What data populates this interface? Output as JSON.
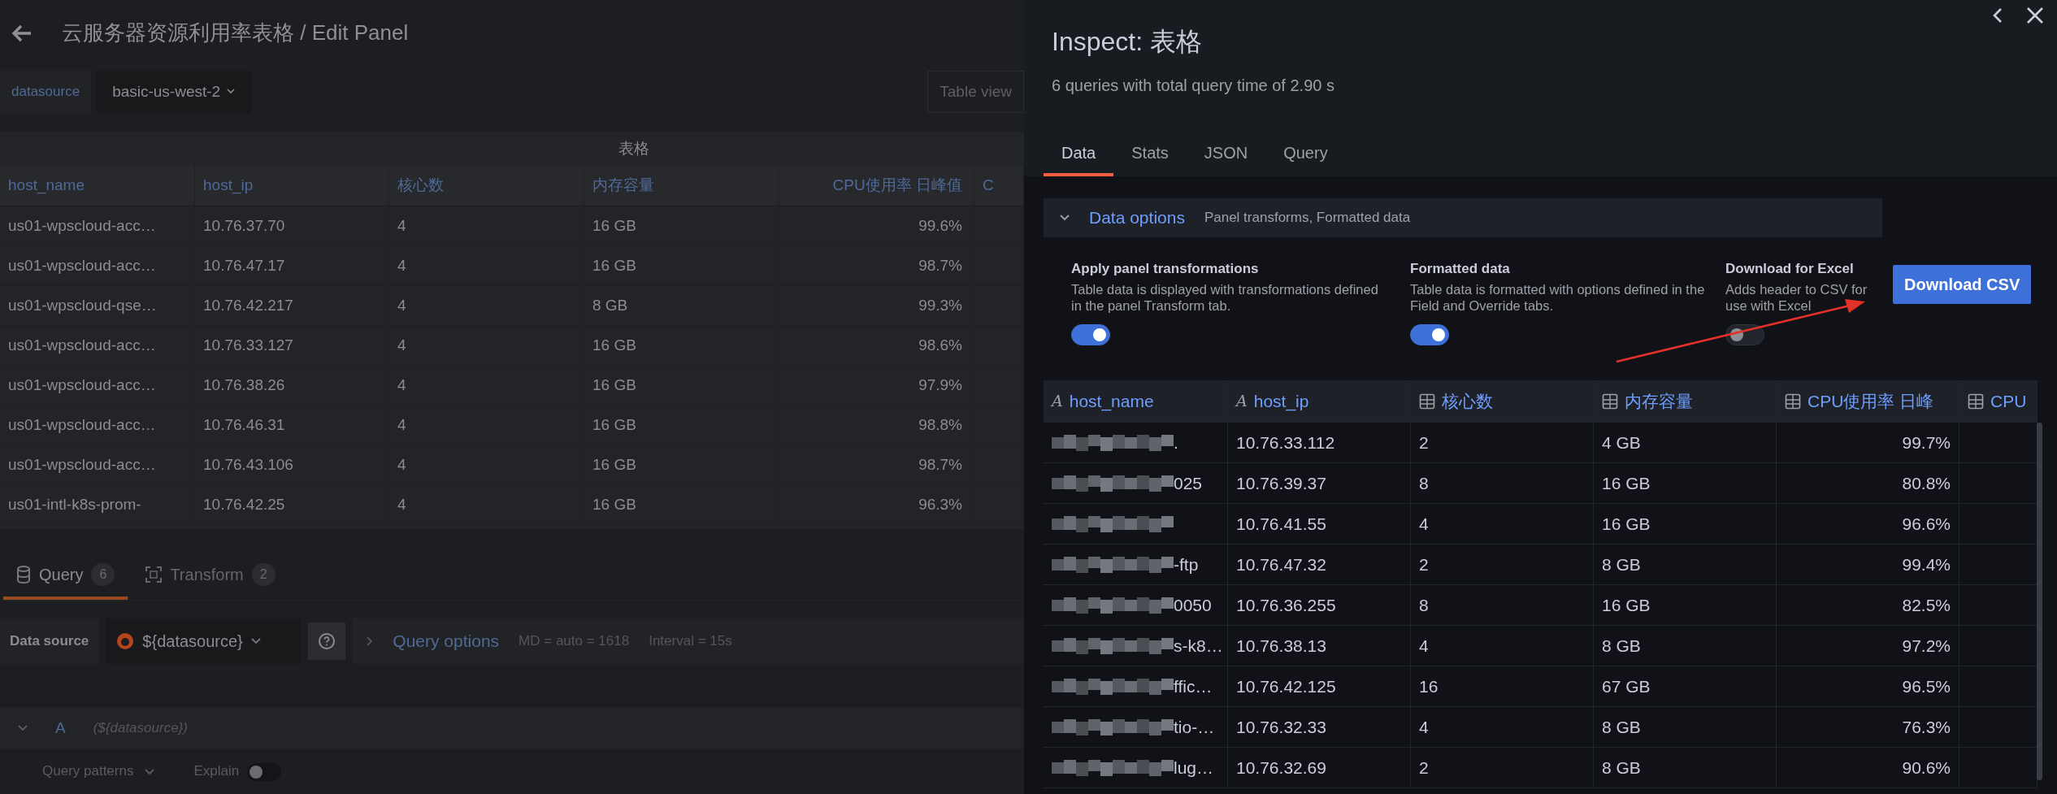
{
  "editor": {
    "title": "云服务器资源利用率表格 / Edit Panel",
    "variable": {
      "label": "datasource",
      "value": "basic-us-west-2"
    },
    "view_button": "Table view",
    "panel": {
      "title": "表格",
      "columns": [
        "host_name",
        "host_ip",
        "核心数",
        "内存容量",
        "CPU使用率 日峰值",
        "C"
      ],
      "rows": [
        [
          "us01-wpscloud-acc…",
          "10.76.37.70",
          "4",
          "16 GB",
          "99.6%"
        ],
        [
          "us01-wpscloud-acc…",
          "10.76.47.17",
          "4",
          "16 GB",
          "98.7%"
        ],
        [
          "us01-wpscloud-qse…",
          "10.76.42.217",
          "4",
          "8 GB",
          "99.3%"
        ],
        [
          "us01-wpscloud-acc…",
          "10.76.33.127",
          "4",
          "16 GB",
          "98.6%"
        ],
        [
          "us01-wpscloud-acc…",
          "10.76.38.26",
          "4",
          "16 GB",
          "97.9%"
        ],
        [
          "us01-wpscloud-acc…",
          "10.76.46.31",
          "4",
          "16 GB",
          "98.8%"
        ],
        [
          "us01-wpscloud-acc…",
          "10.76.43.106",
          "4",
          "16 GB",
          "98.7%"
        ],
        [
          "us01-intl-k8s-prom-",
          "10.76.42.25",
          "4",
          "16 GB",
          "96.3%"
        ]
      ]
    },
    "query_tabs": [
      {
        "label": "Query",
        "count": "6",
        "selected": true,
        "kind": "database"
      },
      {
        "label": "Transform",
        "count": "2",
        "selected": false,
        "kind": "transform"
      }
    ],
    "data_source": {
      "label": "Data source",
      "value": "${datasource}",
      "options_label": "Query options",
      "max_data_points": "MD = auto = 1618",
      "interval": "Interval = 15s"
    },
    "query": {
      "letter": "A",
      "datasource": "(${datasource})",
      "patterns": "Query patterns",
      "explain": "Explain",
      "explain_on": false
    }
  },
  "inspect": {
    "title": "Inspect: 表格",
    "subtitle": "6 queries with total query time of 2.90 s",
    "tabs": [
      {
        "label": "Data",
        "selected": true
      },
      {
        "label": "Stats",
        "selected": false
      },
      {
        "label": "JSON",
        "selected": false
      },
      {
        "label": "Query",
        "selected": false
      }
    ],
    "data_options": {
      "label": "Data options",
      "summary": "Panel transforms, Formatted data",
      "expanded": true
    },
    "options": [
      {
        "title": "Apply panel transformations",
        "description": "Table data is displayed with transformations defined in the panel Transform tab.",
        "on": true
      },
      {
        "title": "Formatted data",
        "description": "Table data is formatted with options defined in the Field and Override tabs.",
        "on": true
      },
      {
        "title": "Download for Excel",
        "description": "Adds header to CSV for use with Excel",
        "on": false
      }
    ],
    "download_button": "Download CSV",
    "columns": [
      {
        "name": "host_name",
        "kind": "string",
        "type_symbol": "A"
      },
      {
        "name": "host_ip",
        "kind": "string",
        "type_symbol": "A"
      },
      {
        "name": "核心数",
        "kind": "number"
      },
      {
        "name": "内存容量",
        "kind": "number"
      },
      {
        "name": "CPU使用率 日峰",
        "kind": "number"
      },
      {
        "name": "CPU",
        "kind": "number"
      }
    ],
    "rows": [
      {
        "host_name": ".",
        "redacted": true,
        "host_ip": "10.76.33.112",
        "cores": "2",
        "memory": "4 GB",
        "cpu_peak": "99.7%"
      },
      {
        "host_name": "025",
        "redacted": true,
        "host_ip": "10.76.39.37",
        "cores": "8",
        "memory": "16 GB",
        "cpu_peak": "80.8%"
      },
      {
        "redacted": true,
        "host_ip": "10.76.41.55",
        "cores": "4",
        "memory": "16 GB",
        "cpu_peak": "96.6%"
      },
      {
        "host_name": "-ftp",
        "redacted": true,
        "host_ip": "10.76.47.32",
        "cores": "2",
        "memory": "8 GB",
        "cpu_peak": "99.4%"
      },
      {
        "host_name": "0050",
        "redacted": true,
        "host_ip": "10.76.36.255",
        "cores": "8",
        "memory": "16 GB",
        "cpu_peak": "82.5%"
      },
      {
        "host_name": "s-k8…",
        "redacted": true,
        "host_ip": "10.76.38.13",
        "cores": "4",
        "memory": "8 GB",
        "cpu_peak": "97.2%"
      },
      {
        "host_name": "ffic…",
        "redacted": true,
        "host_ip": "10.76.42.125",
        "cores": "16",
        "memory": "67 GB",
        "cpu_peak": "96.5%"
      },
      {
        "host_name": "tio-…",
        "redacted": true,
        "host_ip": "10.76.32.33",
        "cores": "4",
        "memory": "8 GB",
        "cpu_peak": "76.3%"
      },
      {
        "host_name": "lug…",
        "redacted": true,
        "host_ip": "10.76.32.69",
        "cores": "2",
        "memory": "8 GB",
        "cpu_peak": "90.6%"
      }
    ]
  }
}
